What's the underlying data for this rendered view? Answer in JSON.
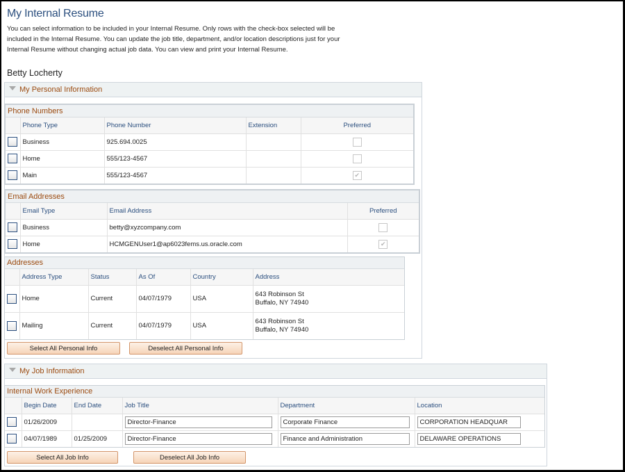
{
  "page": {
    "title": "My Internal Resume",
    "intro": "You can select information to be included in your Internal Resume. Only rows with the check-box selected will be included in the Internal Resume. You can update the job title, department, and/or location descriptions just for your Internal Resume without changing actual job data. You can view and print your Internal Resume.",
    "person_name": "Betty Locherty"
  },
  "personal": {
    "section_title": "My Personal Information",
    "phones": {
      "title": "Phone Numbers",
      "headers": [
        "Phone Type",
        "Phone Number",
        "Extension",
        "Preferred"
      ],
      "rows": [
        {
          "type": "Business",
          "number": "925.694.0025",
          "extension": "",
          "preferred": false
        },
        {
          "type": "Home",
          "number": "555/123-4567",
          "extension": "",
          "preferred": false
        },
        {
          "type": "Main",
          "number": "555/123-4567",
          "extension": "",
          "preferred": true
        }
      ]
    },
    "emails": {
      "title": "Email Addresses",
      "headers": [
        "Email Type",
        "Email Address",
        "Preferred"
      ],
      "rows": [
        {
          "type": "Business",
          "address": "betty@xyzcompany.com",
          "preferred": false
        },
        {
          "type": "Home",
          "address": "HCMGENUser1@ap6023fems.us.oracle.com",
          "preferred": true
        }
      ]
    },
    "addresses": {
      "title": "Addresses",
      "headers": [
        "Address Type",
        "Status",
        "As Of",
        "Country",
        "Address"
      ],
      "rows": [
        {
          "type": "Home",
          "status": "Current",
          "as_of": "04/07/1979",
          "country": "USA",
          "line1": "643 Robinson St",
          "line2": "Buffalo, NY 74940"
        },
        {
          "type": "Mailing",
          "status": "Current",
          "as_of": "04/07/1979",
          "country": "USA",
          "line1": "643 Robinson St",
          "line2": "Buffalo, NY 74940"
        }
      ]
    },
    "select_all_label": "Select All Personal Info",
    "deselect_all_label": "Deselect All Personal Info"
  },
  "job": {
    "section_title": "My Job Information",
    "experience": {
      "title": "Internal Work Experience",
      "headers": [
        "Begin Date",
        "End Date",
        "Job Title",
        "Department",
        "Location"
      ],
      "rows": [
        {
          "begin": "01/26/2009",
          "end": "",
          "job_title": "Director-Finance",
          "department": "Corporate Finance",
          "location": "CORPORATION HEADQUAR"
        },
        {
          "begin": "04/07/1989",
          "end": "01/25/2009",
          "job_title": "Director-Finance",
          "department": "Finance and Administration",
          "location": "DELAWARE OPERATIONS"
        }
      ]
    },
    "select_all_label": "Select All Job Info",
    "deselect_all_label": "Deselect All Job Info"
  },
  "icons": {
    "collapse": "triangle-down",
    "checkmark": "✔"
  }
}
